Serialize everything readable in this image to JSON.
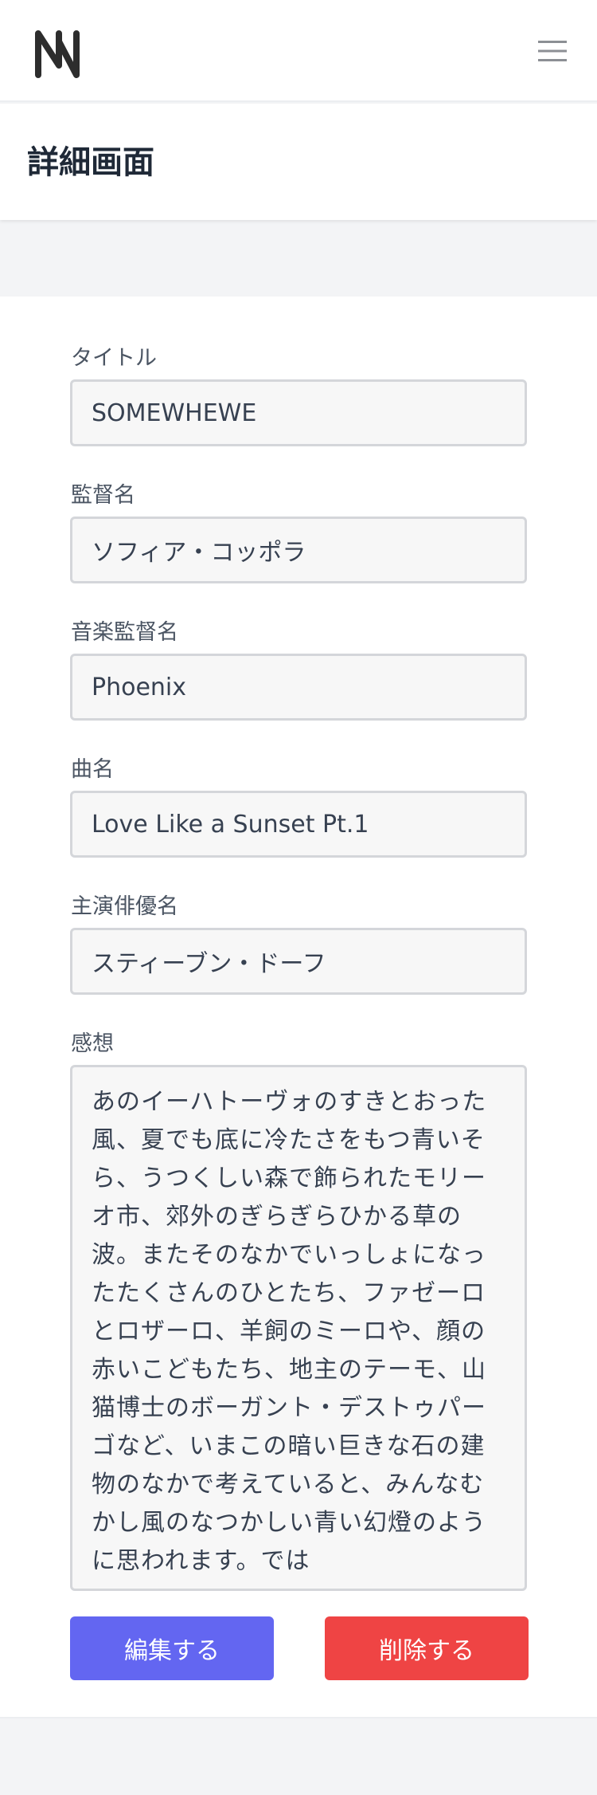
{
  "navbar": {
    "logo_icon": "nm-logo-icon",
    "menu_icon": "hamburger-menu-icon"
  },
  "header": {
    "title": "詳細画面"
  },
  "form": {
    "title_label": "タイトル",
    "title_value": "SOMEWHEWE",
    "director_label": "監督名",
    "director_value": "ソフィア・コッポラ",
    "music_director_label": "音楽監督名",
    "music_director_value": "Phoenix",
    "song_label": "曲名",
    "song_value": "Love Like a Sunset Pt.1",
    "lead_actor_label": "主演俳優名",
    "lead_actor_value": "スティーブン・ドーフ",
    "impression_label": "感想",
    "impression_value": "あのイーハトーヴォのすきとおった風、夏でも底に冷たさをもつ青いそら、うつくしい森で飾られたモリーオ市、郊外のぎらぎらひかる草の波。またそのなかでいっしょになったたくさんのひとたち、ファゼーロとロザーロ、羊飼のミーロや、顔の赤いこどもたち、地主のテーモ、山猫博士のボーガント・デストゥパーゴなど、いまこの暗い巨きな石の建物のなかで考えていると、みんなむかし風のなつかしい青い幻燈のように思われます。では"
  },
  "actions": {
    "edit_label": "編集する",
    "delete_label": "削除する"
  },
  "colors": {
    "edit_button": "#6366f1",
    "delete_button": "#ef4444",
    "page_background": "#f3f4f6"
  }
}
